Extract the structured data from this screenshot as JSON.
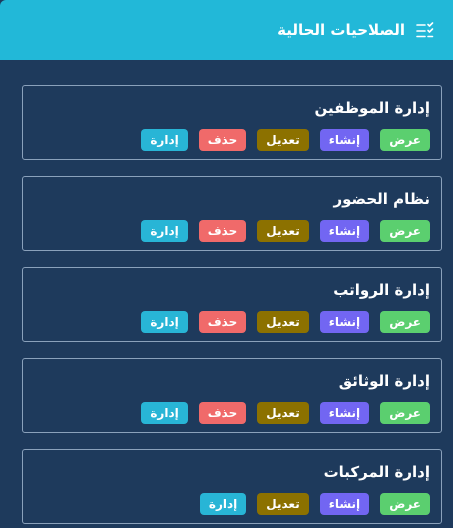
{
  "header": {
    "title": "الصلاحيات الحالية",
    "icon": "checklist-icon"
  },
  "colors": {
    "header_bg": "#22b8d8",
    "panel_bg": "#1e3a5c",
    "view": "#5bcf6f",
    "create": "#7266f2",
    "edit": "#8c7100",
    "delete": "#f06a6a",
    "manage": "#28b5d6"
  },
  "modules": [
    {
      "title": "إدارة الموظفين",
      "permissions": [
        "عرض",
        "إنشاء",
        "تعديل",
        "حذف",
        "إدارة"
      ]
    },
    {
      "title": "نظام الحضور",
      "permissions": [
        "عرض",
        "إنشاء",
        "تعديل",
        "حذف",
        "إدارة"
      ]
    },
    {
      "title": "إدارة الرواتب",
      "permissions": [
        "عرض",
        "إنشاء",
        "تعديل",
        "حذف",
        "إدارة"
      ]
    },
    {
      "title": "إدارة الوثائق",
      "permissions": [
        "عرض",
        "إنشاء",
        "تعديل",
        "حذف",
        "إدارة"
      ]
    },
    {
      "title": "إدارة المركبات",
      "permissions": [
        "عرض",
        "إنشاء",
        "تعديل",
        "إدارة"
      ]
    }
  ]
}
